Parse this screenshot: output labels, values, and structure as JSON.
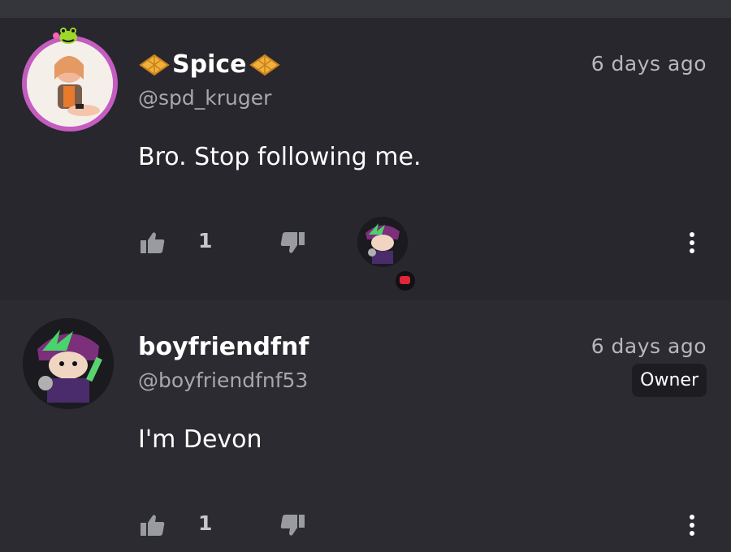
{
  "comments": [
    {
      "display_name": "Spice",
      "handle": "@spd_kruger",
      "timestamp": "6 days ago",
      "text": "Bro. Stop following me.",
      "likes": "1",
      "icons": [
        "waffle-icon",
        "waffle-icon"
      ]
    },
    {
      "display_name": "boyfriendfnf",
      "handle": "@boyfriendfnf53",
      "timestamp": "6 days ago",
      "text": "I'm Devon",
      "likes": "1",
      "badge": "Owner"
    }
  ],
  "colors": {
    "background": "#27272d",
    "accent_avatar_ring": "#c55cc0",
    "reply_badge": "#e0263a"
  }
}
